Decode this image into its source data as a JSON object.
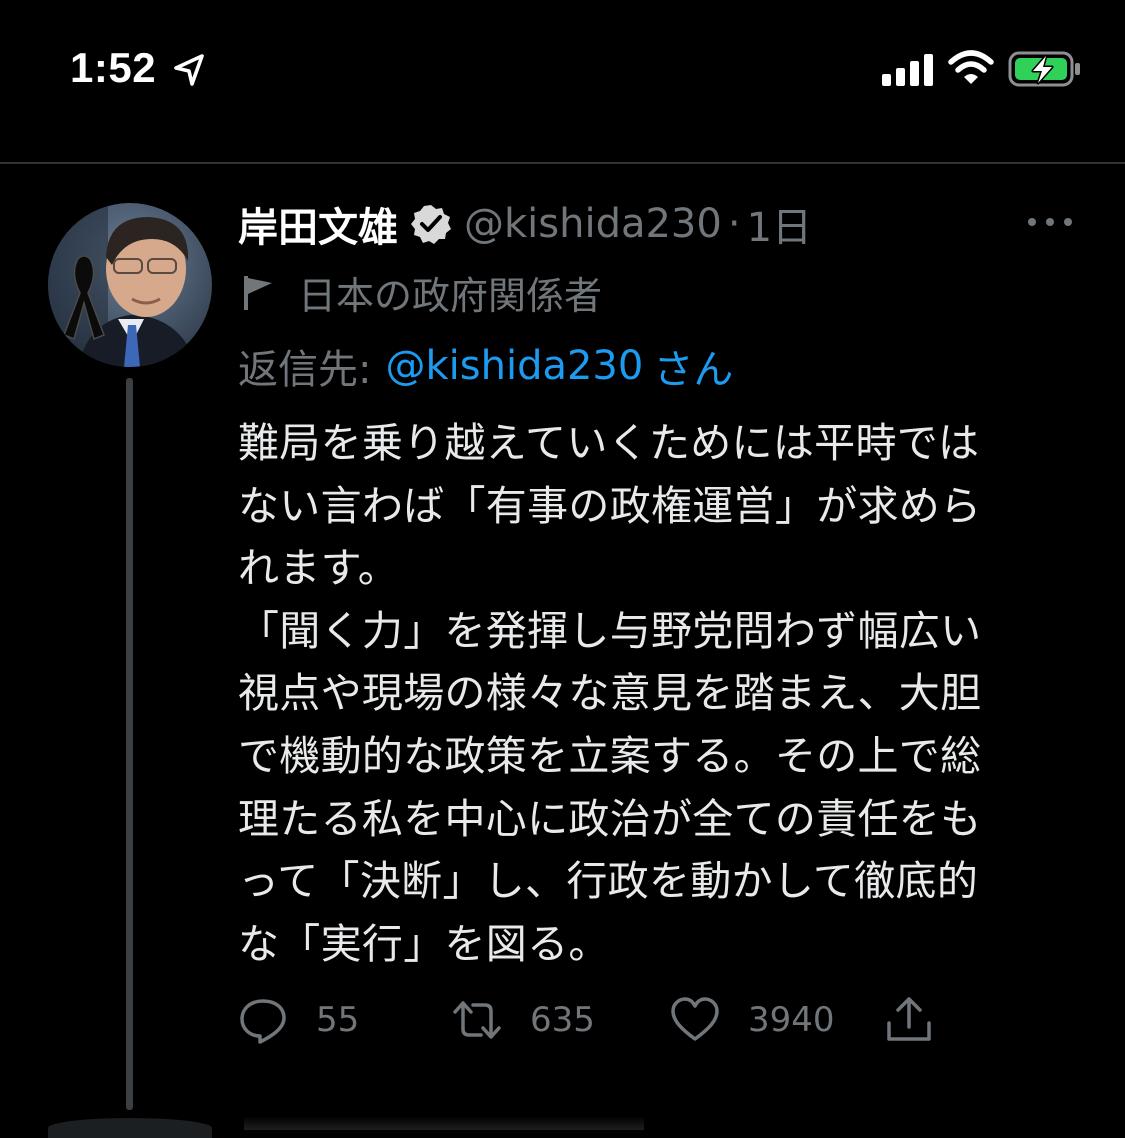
{
  "status_bar": {
    "time": "1:52",
    "icons": [
      "location-arrow-icon",
      "signal-bars-icon",
      "wifi-icon",
      "battery-charging-icon"
    ]
  },
  "tweet": {
    "author_name": "岸田文雄",
    "handle": "@kishida230",
    "separator": "·",
    "time": "1日",
    "account_label": "日本の政府関係者",
    "reply_prefix": "返信先:",
    "reply_handle": "@kishida230",
    "reply_suffix": "さん",
    "body_lines": [
      "難局を乗り越えていくためには平時では",
      "ない言わば「有事の政権運営」が求めら",
      "れます。",
      "「聞く力」を発揮し与野党問わず幅広い",
      "視点や現場の様々な意見を踏まえ、大胆",
      "で機動的な政策を立案する。その上で総",
      "理たる私を中心に政治が全ての責任をも",
      "って「決断」し、行政を動かして徹底的",
      "な「実行」を図る。"
    ],
    "actions": {
      "replies": "55",
      "retweets": "635",
      "likes": "3940"
    }
  },
  "colors": {
    "background": "#000000",
    "text": "#e7e9ea",
    "secondary": "#71767b",
    "link": "#1d9bf0",
    "battery": "#30d158"
  }
}
